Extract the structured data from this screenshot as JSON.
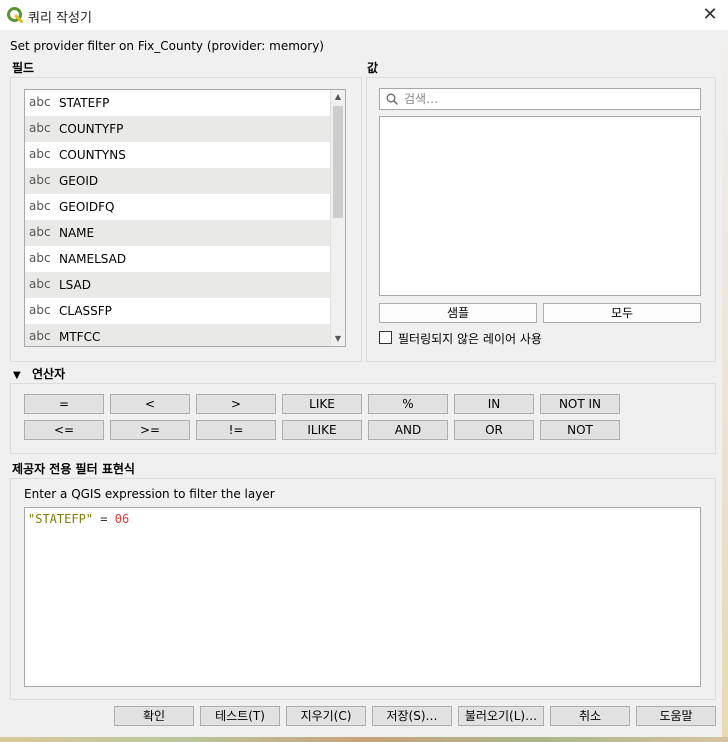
{
  "window": {
    "title": "쿼리 작성기"
  },
  "info_text": "Set provider filter on Fix_County (provider: memory)",
  "fields": {
    "label": "필드",
    "items": [
      {
        "type": "abc",
        "name": "STATEFP"
      },
      {
        "type": "abc",
        "name": "COUNTYFP"
      },
      {
        "type": "abc",
        "name": "COUNTYNS"
      },
      {
        "type": "abc",
        "name": "GEOID"
      },
      {
        "type": "abc",
        "name": "GEOIDFQ"
      },
      {
        "type": "abc",
        "name": "NAME"
      },
      {
        "type": "abc",
        "name": "NAMELSAD"
      },
      {
        "type": "abc",
        "name": "LSAD"
      },
      {
        "type": "abc",
        "name": "CLASSFP"
      },
      {
        "type": "abc",
        "name": "MTFCC"
      }
    ]
  },
  "values": {
    "label": "값",
    "search_placeholder": "검색…",
    "sample_button": "샘플",
    "all_button": "모두",
    "unfiltered_checkbox_label": "필터링되지 않은 레이어 사용",
    "unfiltered_checked": false
  },
  "operators": {
    "label": "연산자",
    "row1": [
      "=",
      "<",
      ">",
      "LIKE",
      "%",
      "IN",
      "NOT IN"
    ],
    "row2": [
      "<=",
      ">=",
      "!=",
      "ILIKE",
      "AND",
      "OR",
      "NOT"
    ]
  },
  "expression": {
    "label": "제공자 전용 필터 표현식",
    "hint": "Enter a QGIS expression to filter the layer",
    "field_token": "\"STATEFP\"",
    "operator_token": "=",
    "value_token": "06"
  },
  "buttons": {
    "ok": "확인",
    "test": "테스트(T)",
    "clear": "지우기(C)",
    "save": "저장(S)…",
    "load": "불러오기(L)…",
    "cancel": "취소",
    "help": "도움말"
  },
  "colors": {
    "field_token": "#808000",
    "value_token": "#e0403a",
    "alt_row": "#e9e9e7",
    "qgis_green": "#589632",
    "qgis_yellow": "#eebd1a"
  }
}
